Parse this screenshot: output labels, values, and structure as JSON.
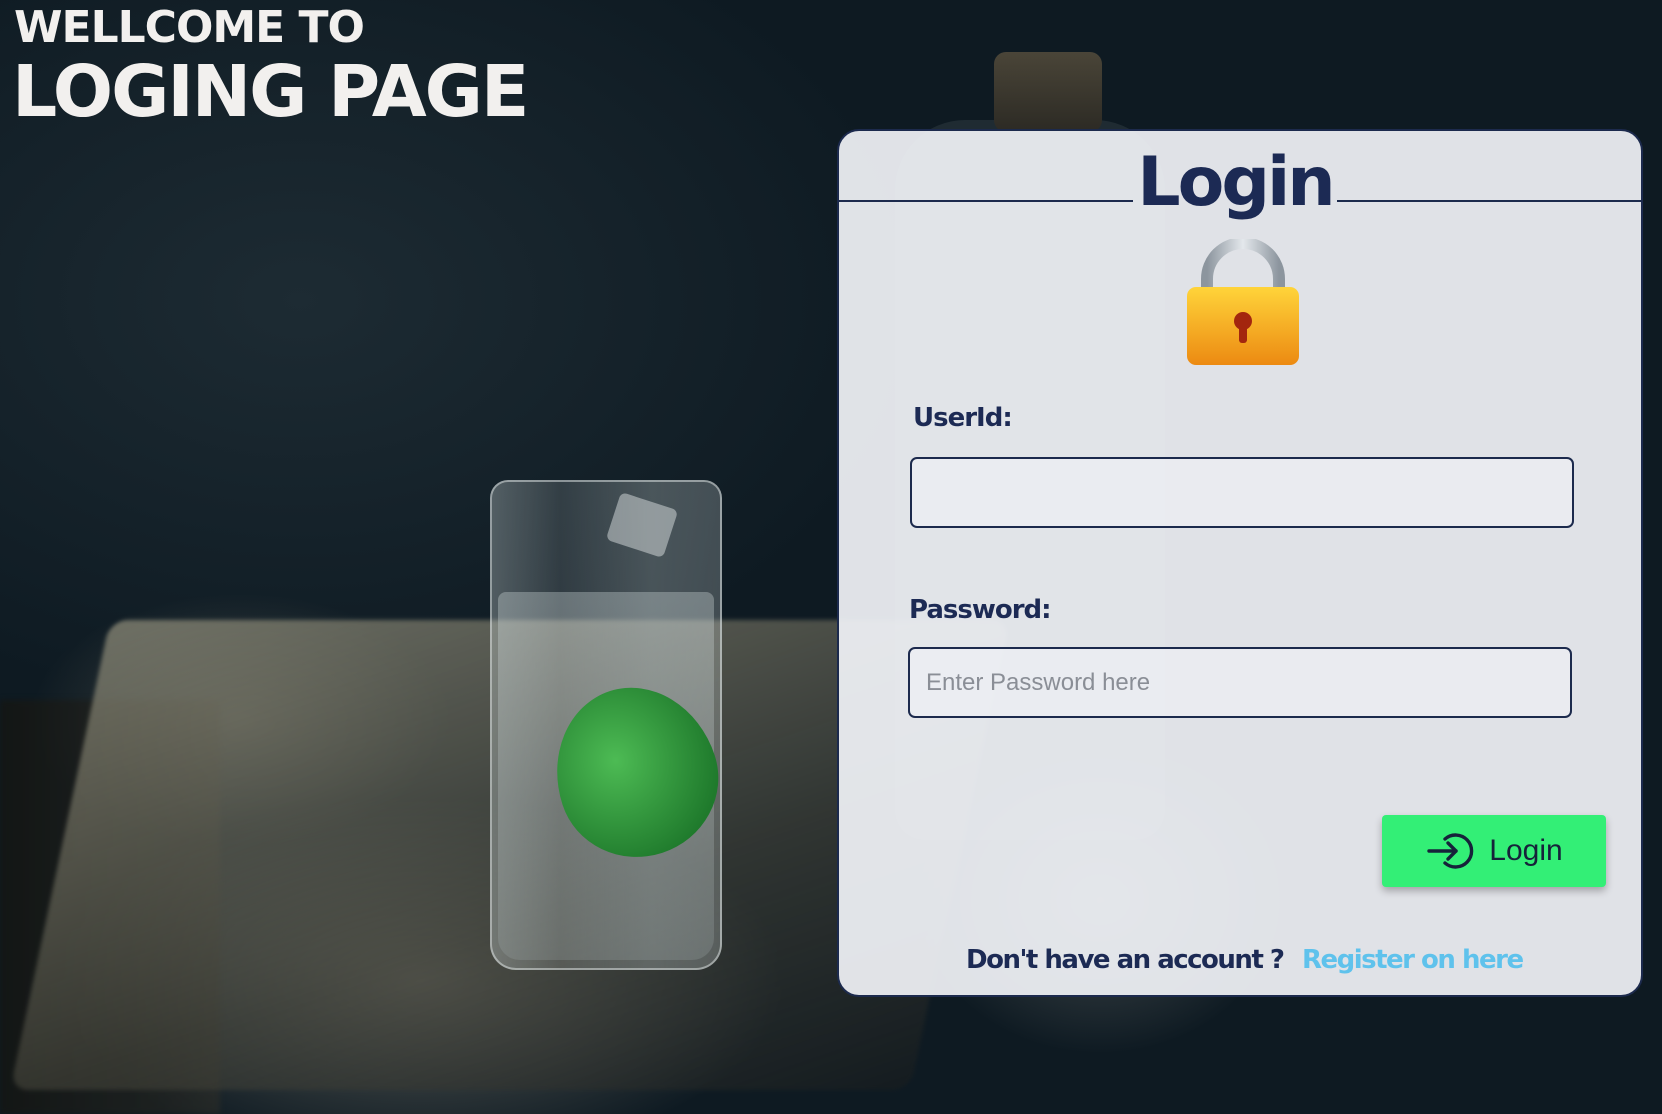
{
  "headline": {
    "line1": "WELLCOME TO",
    "line2": "LOGING PAGE"
  },
  "card": {
    "title": "Login",
    "lock_icon": "lock-icon",
    "userid": {
      "label": "UserId:",
      "value": "",
      "placeholder": ""
    },
    "password": {
      "label": "Password:",
      "value": "",
      "placeholder": "Enter Password here"
    },
    "login_button": {
      "label": "Login",
      "icon": "login-arrow-icon"
    },
    "footer": {
      "text": "Don't have an account ?",
      "link": "Register on here"
    }
  },
  "colors": {
    "primary_navy": "#1c2a54",
    "button_green": "#33ef76",
    "link_blue": "#5fc2ec",
    "lock_gold": "#f5b51e"
  }
}
